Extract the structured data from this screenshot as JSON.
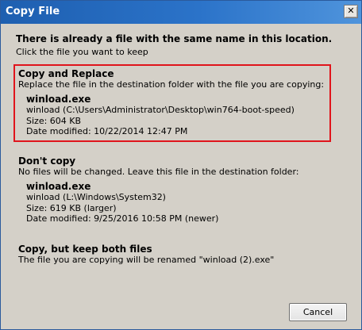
{
  "window": {
    "title": "Copy File",
    "close_glyph": "✕",
    "close_icon": "close-icon"
  },
  "header": {
    "heading": "There is already a file with the same name in this location.",
    "subheading": "Click the file you want to keep"
  },
  "options": {
    "replace": {
      "title": "Copy and Replace",
      "description": "Replace the file in the destination folder with the file you are copying:",
      "file": {
        "name": "winload.exe",
        "location": "winload (C:\\Users\\Administrator\\Desktop\\win764-boot-speed)",
        "size": "Size: 604 KB",
        "modified": "Date modified: 10/22/2014 12:47 PM"
      }
    },
    "dont_copy": {
      "title": "Don't copy",
      "description": "No files will be changed. Leave this file in the destination folder:",
      "file": {
        "name": "winload.exe",
        "location": "winload (L:\\Windows\\System32)",
        "size": "Size: 619 KB (larger)",
        "modified": "Date modified: 9/25/2016 10:58 PM (newer)"
      }
    },
    "keep_both": {
      "title": "Copy, but keep both files",
      "description": "The file you are copying will be renamed \"winload (2).exe\""
    }
  },
  "footer": {
    "cancel_label": "Cancel"
  },
  "colors": {
    "titlebar": "#2b73c9",
    "dialog_bg": "#d4d0c8",
    "highlight_border": "#e0141c"
  }
}
